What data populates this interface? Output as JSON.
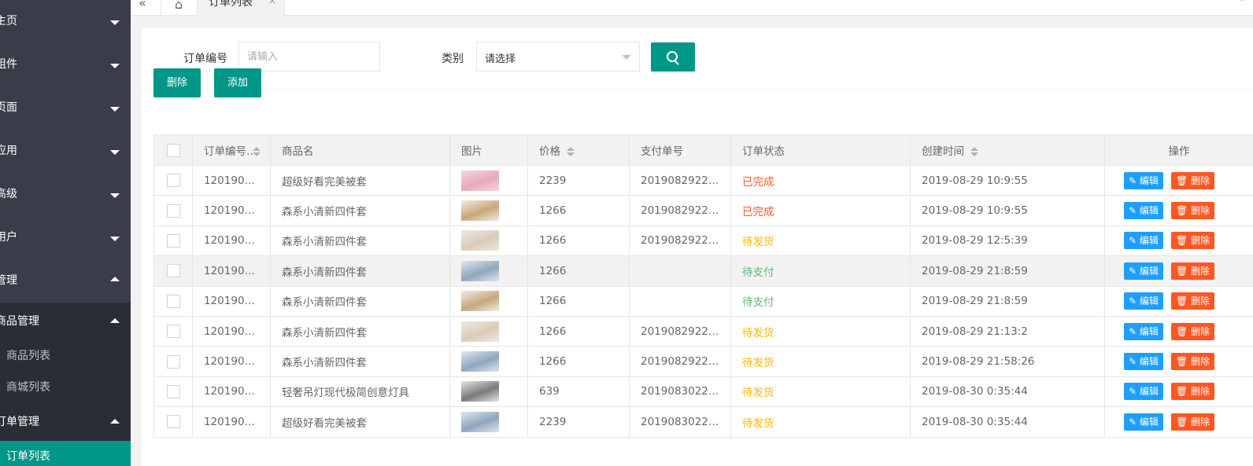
{
  "sidebar": {
    "items": [
      {
        "label": "主页",
        "expanded": false
      },
      {
        "label": "组件",
        "expanded": false
      },
      {
        "label": "页面",
        "expanded": false
      },
      {
        "label": "应用",
        "expanded": false
      },
      {
        "label": "高级",
        "expanded": false
      },
      {
        "label": "用户",
        "expanded": false
      },
      {
        "label": "管理",
        "expanded": true
      }
    ],
    "goods_group": {
      "label": "商品管理",
      "children": [
        "商品列表",
        "商城列表"
      ]
    },
    "order_group": {
      "label": "订单管理",
      "children": [
        "订单列表"
      ]
    }
  },
  "topbar": {
    "back_icon": "«",
    "home_icon": "⌂",
    "tab_label": "订单列表",
    "tab_close": "×",
    "right_text": "»"
  },
  "filter": {
    "order_no_label": "订单编号",
    "order_no_placeholder": "请输入",
    "category_label": "类别",
    "category_value": "请选择"
  },
  "toolbar": {
    "delete_label": "删除",
    "add_label": "添加"
  },
  "table": {
    "headers": [
      "订单编号",
      "商品名",
      "图片",
      "价格",
      "支付单号",
      "订单状态",
      "创建时间",
      "操作"
    ],
    "edit_label": "编辑",
    "delete_label": "删除",
    "rows": [
      {
        "order_no": "1201908…",
        "name": "超级好看完美被套",
        "price": "2239",
        "pay_no": "20190829220…",
        "status": "已完成",
        "status_type": "done",
        "created": "2019-08-29 10:9:55",
        "thumb_colors": [
          "#e8aab8",
          "#f4d6dd"
        ]
      },
      {
        "order_no": "1201908…",
        "name": "森系小清新四件套",
        "price": "1266",
        "pay_no": "20190829220…",
        "status": "已完成",
        "status_type": "done",
        "created": "2019-08-29 10:9:55",
        "thumb_colors": [
          "#c8a67c",
          "#f2ece3"
        ]
      },
      {
        "order_no": "1201908…",
        "name": "森系小清新四件套",
        "price": "1266",
        "pay_no": "20190829220…",
        "status": "待发货",
        "status_type": "ship",
        "created": "2019-08-29 12:5:39",
        "thumb_colors": [
          "#d9cbb8",
          "#efe9e1"
        ]
      },
      {
        "order_no": "1201908…",
        "name": "森系小清新四件套",
        "price": "1266",
        "pay_no": "",
        "status": "待支付",
        "status_type": "pay",
        "created": "2019-08-29 21:8:59",
        "thumb_colors": [
          "#8fa6bd",
          "#dfe6ee"
        ]
      },
      {
        "order_no": "1201908…",
        "name": "森系小清新四件套",
        "price": "1266",
        "pay_no": "",
        "status": "待支付",
        "status_type": "pay",
        "created": "2019-08-29 21:8:59",
        "thumb_colors": [
          "#c8a67c",
          "#f2ece3"
        ]
      },
      {
        "order_no": "1201908…",
        "name": "森系小清新四件套",
        "price": "1266",
        "pay_no": "20190829220…",
        "status": "待发货",
        "status_type": "ship",
        "created": "2019-08-29 21:13:2",
        "thumb_colors": [
          "#d9cbb8",
          "#efe9e1"
        ]
      },
      {
        "order_no": "1201908…",
        "name": "森系小清新四件套",
        "price": "1266",
        "pay_no": "20190829220…",
        "status": "待发货",
        "status_type": "ship",
        "created": "2019-08-29 21:58:26",
        "thumb_colors": [
          "#8fa6bd",
          "#dfe6ee"
        ]
      },
      {
        "order_no": "1201908…",
        "name": "轻奢吊灯现代极简创意灯具",
        "price": "639",
        "pay_no": "20190830220…",
        "status": "待发货",
        "status_type": "ship",
        "created": "2019-08-30 0:35:44",
        "thumb_colors": [
          "#7a7a7a",
          "#e5e5e5"
        ]
      },
      {
        "order_no": "1201908…",
        "name": "超级好看完美被套",
        "price": "2239",
        "pay_no": "20190830220…",
        "status": "待发货",
        "status_type": "ship",
        "created": "2019-08-30 0:35:44",
        "thumb_colors": [
          "#8fa6bd",
          "#dfe6ee"
        ]
      }
    ],
    "highlighted_row": 3
  },
  "colors": {
    "primary": "#009688",
    "sidebar_bg": "#393d49",
    "edit": "#1e9fff",
    "danger": "#ff5722",
    "status_done": "#ff5722",
    "status_ship": "#ffb800",
    "status_pay": "#5fb878"
  }
}
